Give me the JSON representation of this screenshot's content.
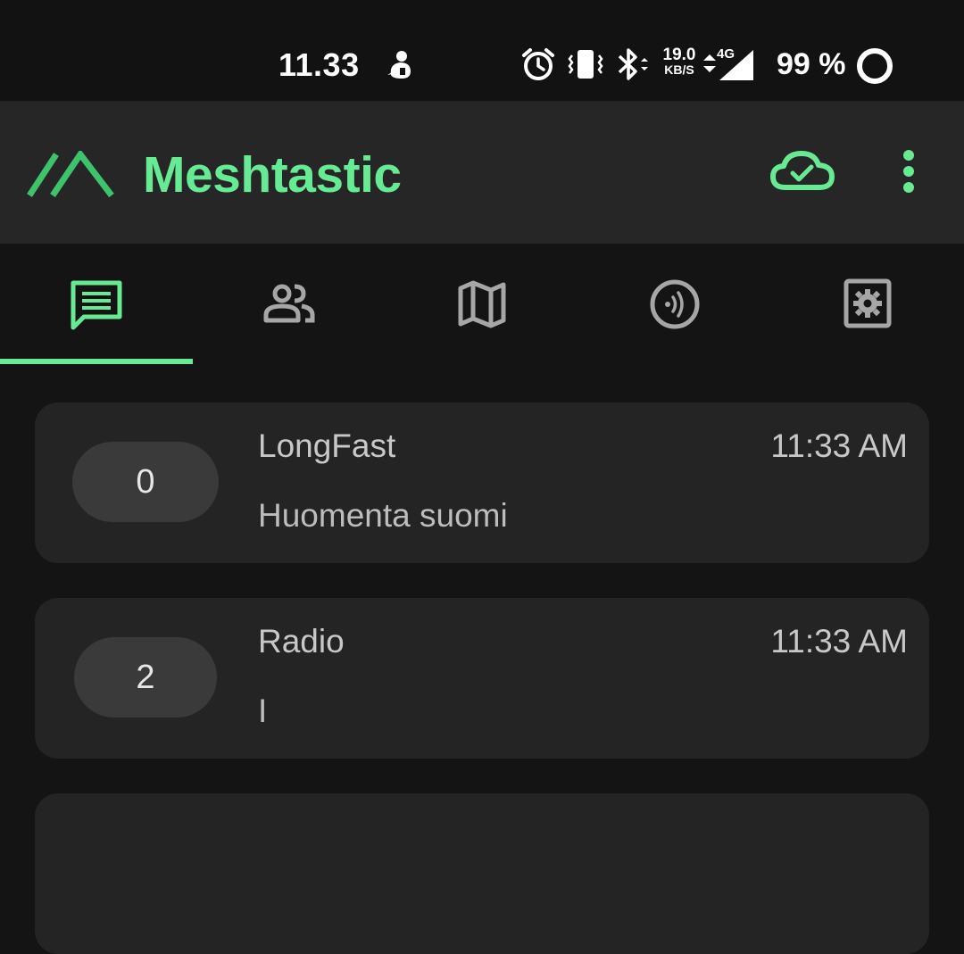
{
  "status_bar": {
    "time": "11.33",
    "net_speed_value": "19.0",
    "net_speed_unit": "KB/S",
    "network_type": "4G",
    "battery_percent": "99 %",
    "icons": [
      "emoji-icon",
      "alarm-icon",
      "vibrate-icon",
      "bluetooth-icon",
      "data-arrows-icon",
      "signal-icon",
      "battery-ring-icon"
    ]
  },
  "app_bar": {
    "title": "Meshtastic",
    "accent_color": "#67ea94",
    "icons": [
      "meshtastic-logo-icon",
      "cloud-check-icon",
      "more-vert-icon"
    ]
  },
  "tabs": [
    {
      "name": "messages",
      "icon": "chat-icon",
      "selected": true
    },
    {
      "name": "nodes",
      "icon": "people-icon",
      "selected": false
    },
    {
      "name": "map",
      "icon": "map-icon",
      "selected": false
    },
    {
      "name": "connection",
      "icon": "radio-signal-icon",
      "selected": false
    },
    {
      "name": "settings",
      "icon": "settings-icon",
      "selected": false
    }
  ],
  "channels": [
    {
      "index": "0",
      "name": "LongFast",
      "time": "11:33 AM",
      "last_message": "Huomenta suomi"
    },
    {
      "index": "2",
      "name": "Radio",
      "time": "11:33 AM",
      "last_message": "I"
    }
  ]
}
